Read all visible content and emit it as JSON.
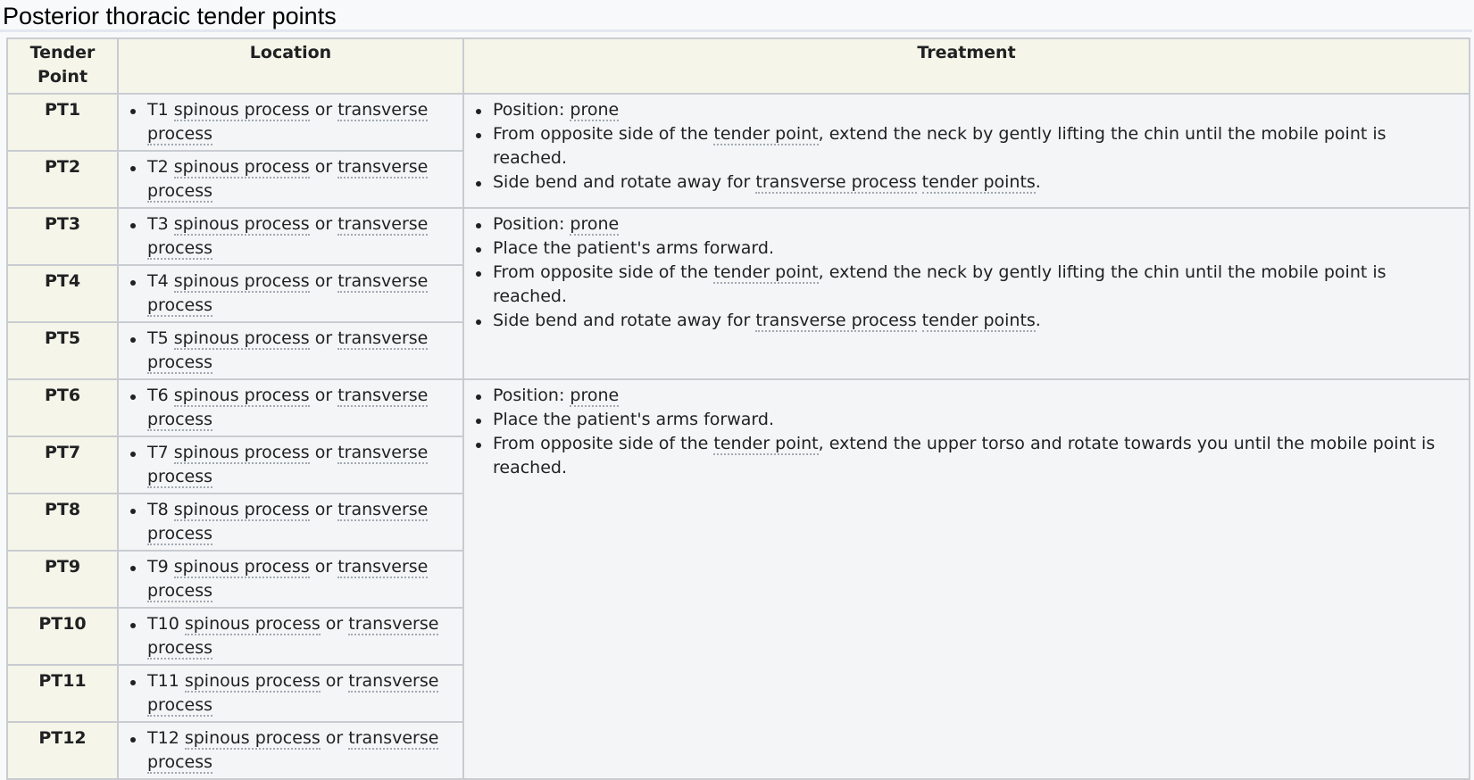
{
  "title": "Posterior thoracic tender points",
  "columns": [
    "Tender Point",
    "Location",
    "Treatment"
  ],
  "location_template": {
    "spinous": "spinous process",
    "or": "or",
    "transverse": "transverse process"
  },
  "rows": [
    {
      "name": "PT1",
      "level": "T1"
    },
    {
      "name": "PT2",
      "level": "T2"
    },
    {
      "name": "PT3",
      "level": "T3"
    },
    {
      "name": "PT4",
      "level": "T4"
    },
    {
      "name": "PT5",
      "level": "T5"
    },
    {
      "name": "PT6",
      "level": "T6"
    },
    {
      "name": "PT7",
      "level": "T7"
    },
    {
      "name": "PT8",
      "level": "T8"
    },
    {
      "name": "PT9",
      "level": "T9"
    },
    {
      "name": "PT10",
      "level": "T10"
    },
    {
      "name": "PT11",
      "level": "T11"
    },
    {
      "name": "PT12",
      "level": "T12"
    }
  ],
  "treatment_groups": [
    {
      "rowspan": 2,
      "items": [
        [
          {
            "t": "Position: "
          },
          {
            "t": "prone",
            "link": true
          }
        ],
        [
          {
            "t": "From opposite side of the "
          },
          {
            "t": "tender point",
            "link": true
          },
          {
            "t": ", extend the neck by gently lifting the chin until the mobile point is reached."
          }
        ],
        [
          {
            "t": "Side bend and rotate away for "
          },
          {
            "t": "transverse process",
            "link": true
          },
          {
            "t": " "
          },
          {
            "t": "tender points",
            "link": true
          },
          {
            "t": "."
          }
        ]
      ]
    },
    {
      "rowspan": 3,
      "items": [
        [
          {
            "t": "Position: "
          },
          {
            "t": "prone",
            "link": true
          }
        ],
        [
          {
            "t": "Place the patient's arms forward."
          }
        ],
        [
          {
            "t": "From opposite side of the "
          },
          {
            "t": "tender point",
            "link": true
          },
          {
            "t": ", extend the neck by gently lifting the chin until the mobile point is reached."
          }
        ],
        [
          {
            "t": "Side bend and rotate away for "
          },
          {
            "t": "transverse process",
            "link": true
          },
          {
            "t": " "
          },
          {
            "t": "tender points",
            "link": true
          },
          {
            "t": "."
          }
        ]
      ]
    },
    {
      "rowspan": 7,
      "items": [
        [
          {
            "t": "Position: "
          },
          {
            "t": "prone",
            "link": true
          }
        ],
        [
          {
            "t": "Place the patient's arms forward."
          }
        ],
        [
          {
            "t": "From opposite side of the "
          },
          {
            "t": "tender point",
            "link": true
          },
          {
            "t": ", extend the upper torso and rotate towards you until the mobile point is reached."
          }
        ]
      ]
    }
  ]
}
